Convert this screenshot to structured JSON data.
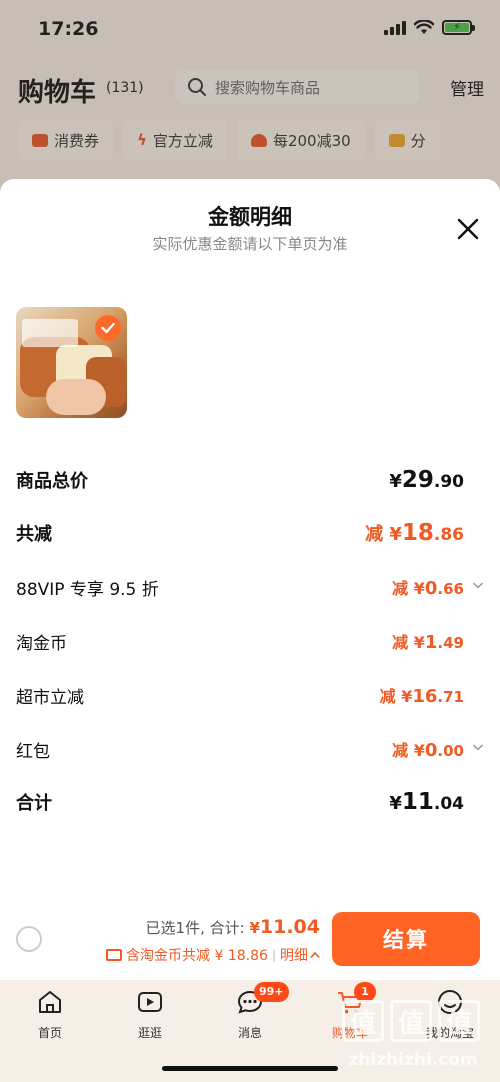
{
  "status_bar": {
    "time": "17:26",
    "battery_icon": "battery-charging-icon"
  },
  "cart_header": {
    "title": "购物车",
    "count": "(131)",
    "search_placeholder": "搜索购物车商品",
    "manage_label": "管理"
  },
  "filters": [
    {
      "label": "消费券",
      "icon": "coupon-icon"
    },
    {
      "label": "官方立减",
      "icon": "lightning-icon"
    },
    {
      "label": "每200减30",
      "icon": "discount-icon"
    },
    {
      "label": "分",
      "icon": "folder-icon"
    }
  ],
  "sheet": {
    "title": "金额明细",
    "subtitle": "实际优惠金额请以下单页为准",
    "rows": {
      "total": {
        "label": "商品总价",
        "prefix": "¥",
        "int": "29",
        "dec": ".90"
      },
      "reduction": {
        "label": "共减",
        "prefix": "减 ¥",
        "int": "18",
        "dec": ".86"
      },
      "vip": {
        "label": "88VIP 专享 9.5 折",
        "prefix": "减 ¥",
        "int": "0",
        "dec": ".66"
      },
      "coins": {
        "label": "淘金币",
        "prefix": "减 ¥",
        "int": "1",
        "dec": ".49"
      },
      "market": {
        "label": "超市立减",
        "prefix": "减 ¥",
        "int": "16",
        "dec": ".71"
      },
      "redpacket": {
        "label": "红包",
        "prefix": "减 ¥",
        "int": "0",
        "dec": ".00"
      },
      "sum": {
        "label": "合计",
        "prefix": "¥",
        "int": "11",
        "dec": ".04"
      }
    }
  },
  "action_bar": {
    "selected_text": "已选1件, 合计:",
    "price_currency": "¥",
    "price_value": "11.04",
    "coin_text": "含淘金币共减 ¥ 18.86",
    "divider": "|",
    "detail_label": "明细",
    "checkout_label": "结算"
  },
  "tabs": [
    {
      "label": "首页",
      "icon": "home-icon"
    },
    {
      "label": "逛逛",
      "icon": "video-icon"
    },
    {
      "label": "消息",
      "icon": "message-icon",
      "badge": "99+"
    },
    {
      "label": "购物车",
      "icon": "cart-icon",
      "badge": "1",
      "active": true
    },
    {
      "label": "我的淘宝",
      "icon": "profile-icon"
    }
  ],
  "watermark": {
    "glyph": "值",
    "text": "zhizhizhi.com"
  },
  "colors": {
    "accent": "#f05a23",
    "button": "#ff6424",
    "badge": "#ff4a17"
  }
}
